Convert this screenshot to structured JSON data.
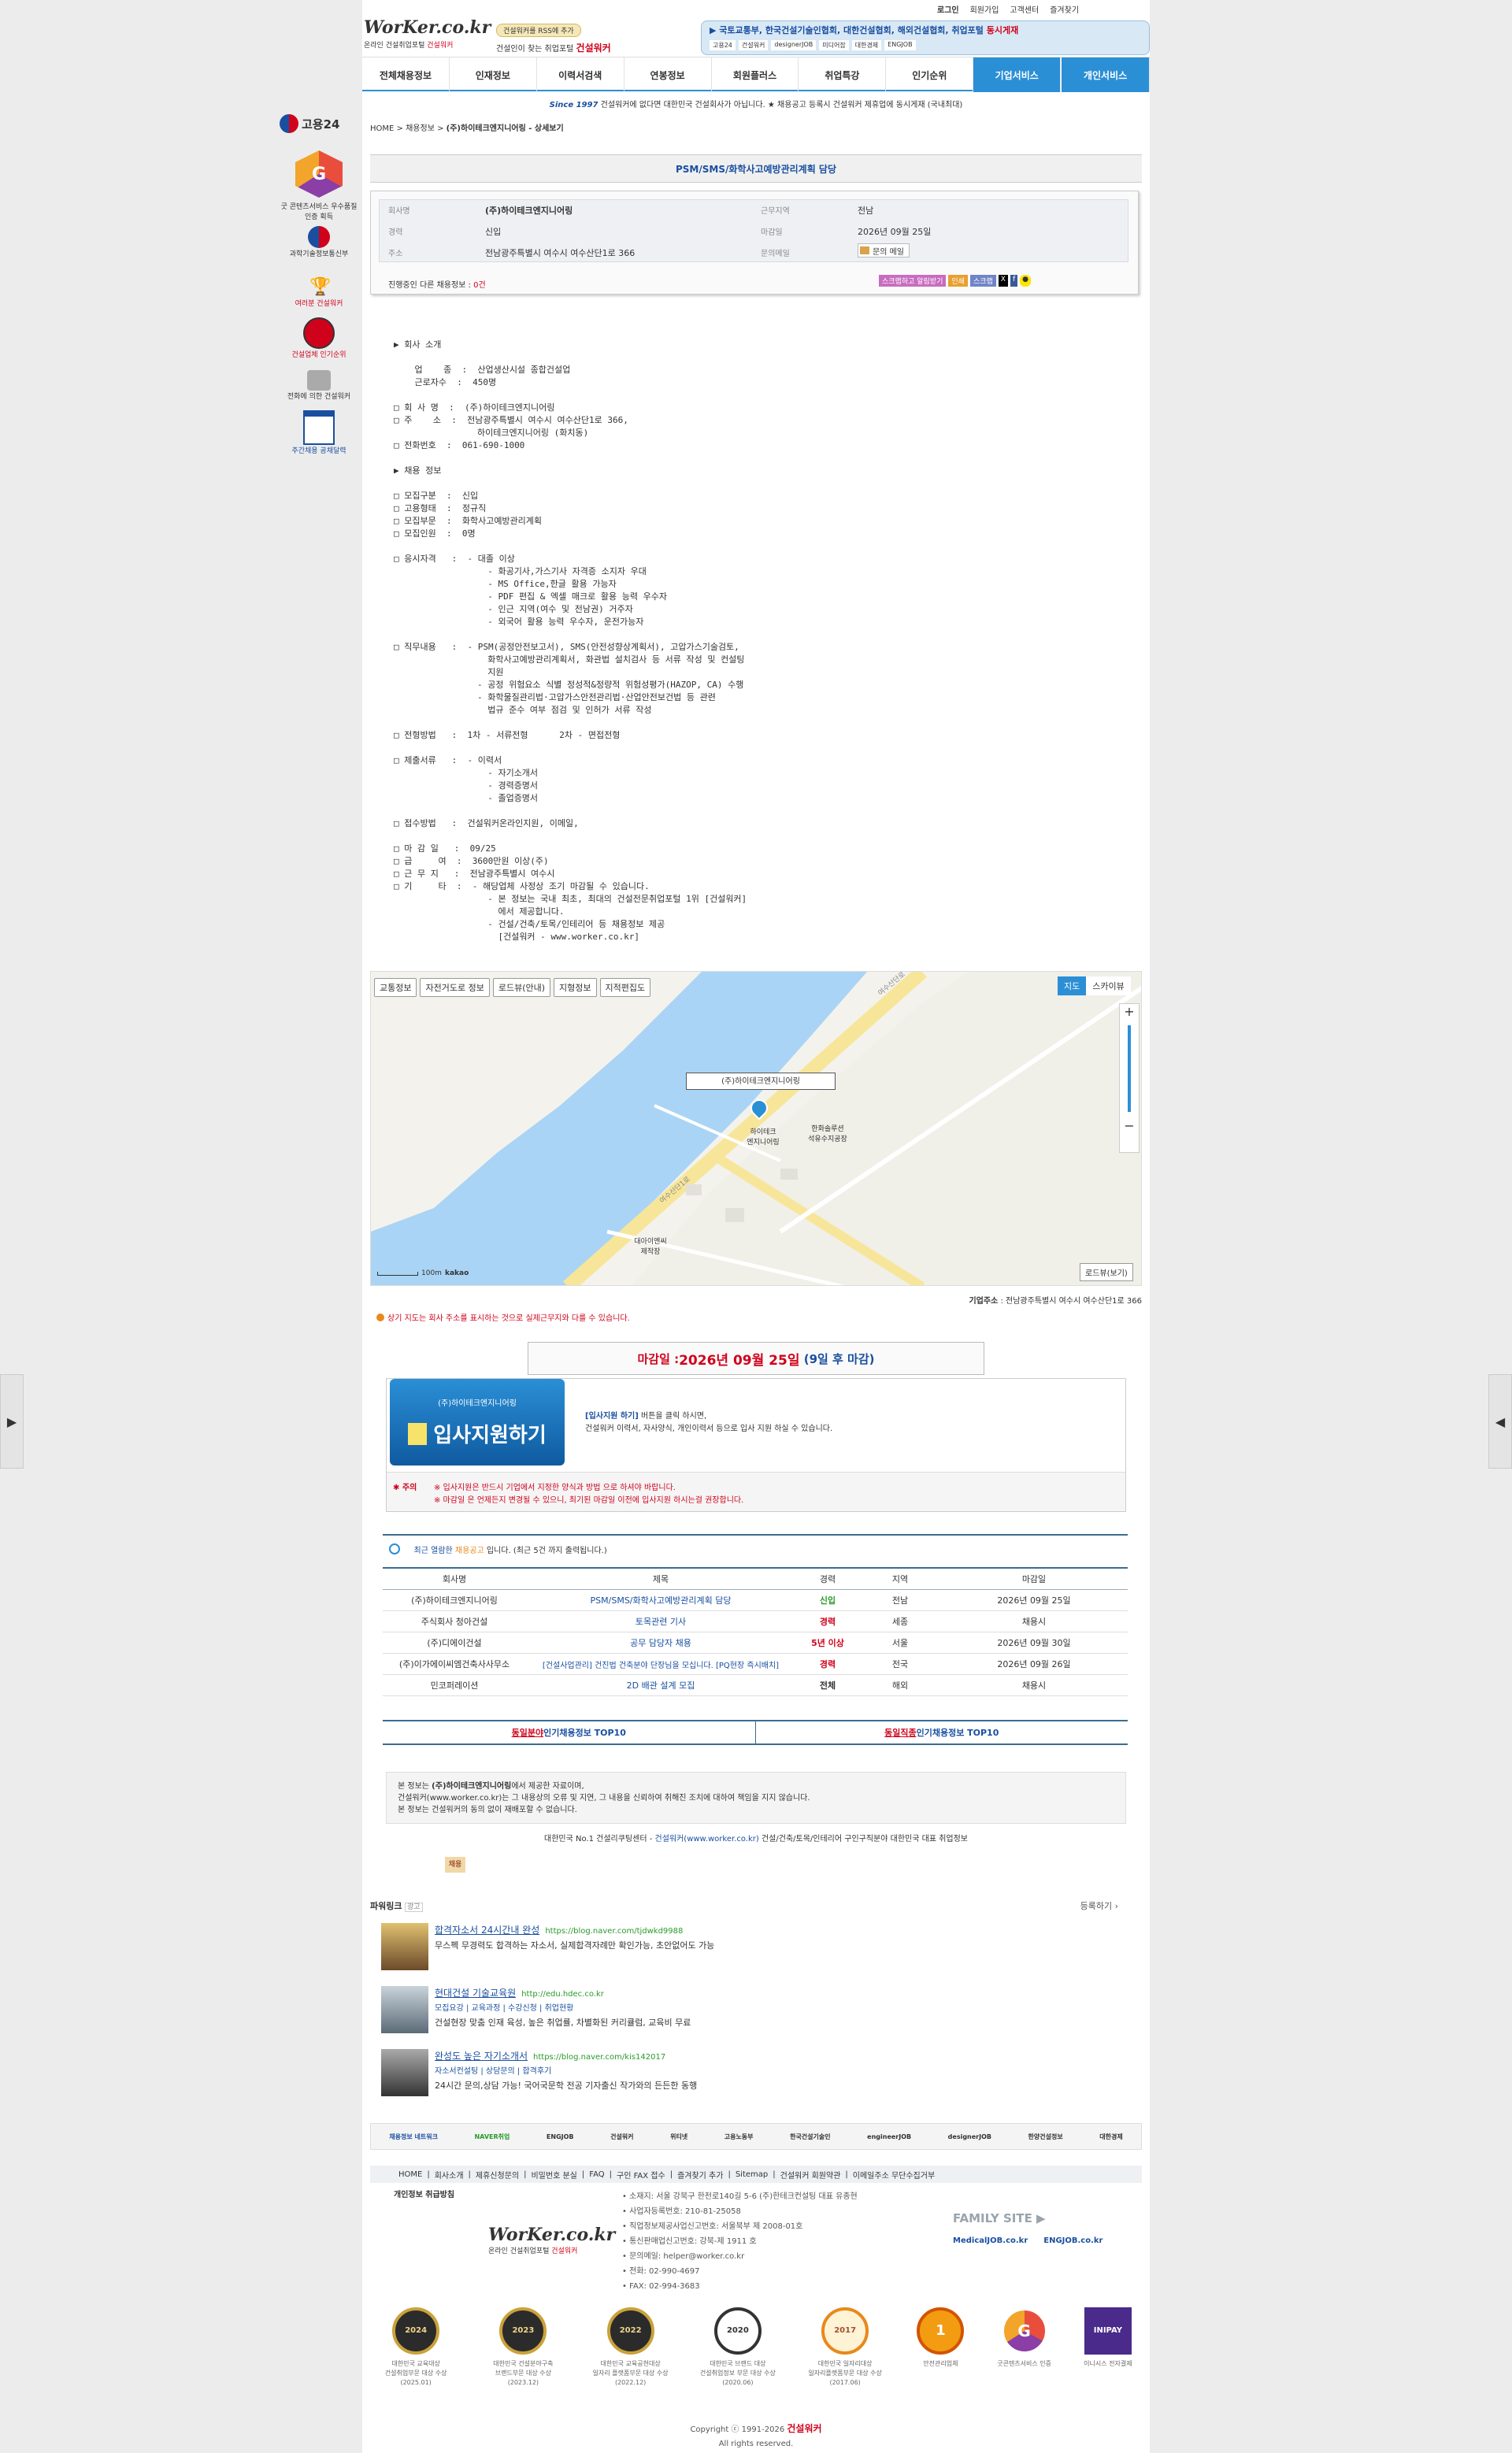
{
  "header": {
    "logo_text": "WorKer.co.kr",
    "logo_sub": "온라인 건설취업포털",
    "logo_sub_brand": "건설워커",
    "slogan_tag": "건설워커를 RSS에 추가",
    "slogan": "건설인이 찾는 취업포털",
    "slogan_brand": "건설워커",
    "top_links": [
      "로그인",
      "회원가입",
      "고객센터",
      "즐겨찾기"
    ],
    "banner_text": "▶ 국토교통부, 한국건설기술인협회, 대한건설협회, 해외건설협회, 취업포털",
    "banner_highlight": "동시게재",
    "banner_logos": [
      "고용24",
      "건설워커",
      "designerJOB",
      "미디어잡",
      "대한경제",
      "ENGJOB"
    ]
  },
  "nav": {
    "items": [
      "전체채용정보",
      "인재정보",
      "이력서검색",
      "연봉정보",
      "회원플러스",
      "취업특강",
      "인기순위"
    ],
    "special": [
      "기업서비스",
      "개인서비스"
    ]
  },
  "notice": {
    "since": "Since 1997",
    "text": "건설워커에 없다면 대한민국 건설회사가 아닙니다. ★ 채용공고 등록시 건설워커 제휴업에 동시게재 (국내최대)"
  },
  "left_sidebar": {
    "logo": "고용24",
    "award1": "굿 콘텐츠서비스 우수품질인증 획득",
    "award2": "과학기술정보통신부",
    "icon1": "여러분 건설워커",
    "icon2": "건설업체 인기순위",
    "icon3": "전화에 의한 건설워커",
    "icon4": "주간채용 공채달력"
  },
  "breadcrumb": [
    "HOME",
    "채용정보",
    "(주)하이테크엔지니어링 - 상세보기"
  ],
  "job": {
    "title": "PSM/SMS/화학사고예방관리계획 담당",
    "company_label": "회사명",
    "company": "(주)하이테크엔지니어링",
    "career_label": "경력",
    "career": "신입",
    "address_label": "주소",
    "address": "전남광주특별시 여수시 여수산단1로 366",
    "location_label": "근무지역",
    "location": "전남",
    "deadline_label": "마감일",
    "deadline": "2026년 09월 25일",
    "contact_label": "문의메일",
    "contact": "문의 메일",
    "ongoing_label": "진행중인 다른 채용정보 :",
    "ongoing_count": "0건",
    "actions": [
      "스크랩하고 알림받기",
      "인쇄",
      "스크랩"
    ]
  },
  "body_text": "▶ 회사 소개\n\n    업    종  :  산업생산시설 종합건설업\n    근로자수  :  450명\n\n□ 회 사 명  :  (주)하이테크엔지니어링\n□ 주    소  :  전남광주특별시 여수시 여수산단1로 366,\n                하이테크엔지니어링 (화치동)\n□ 전화번호  :  061-690-1000\n\n▶ 채용 정보\n\n□ 모집구분  :  신입\n□ 고용형태  :  정규직\n□ 모집부문  :  화학사고예방관리계획\n□ 모집인원  :  0명\n\n□ 응시자격   :  - 대졸 이상\n                  - 화공기사,가스기사 자격증 소지자 우대\n                  - MS Office,한글 활용 가능자\n                  - PDF 편집 & 엑셀 매크로 활용 능력 우수자\n                  - 인근 지역(여수 및 전남권) 거주자\n                  - 외국어 활용 능력 우수자, 운전가능자\n\n□ 직무내용   :  - PSM(공정안전보고서), SMS(안전성향상계획서), 고압가스기술검토,\n                  화학사고예방관리계획서, 화관법 설치검사 등 서류 작성 및 컨설팅\n                  지원\n                - 공정 위험요소 식별 정성적&정량적 위험성평가(HAZOP, CA) 수행\n                - 화학물질관리법·고압가스안전관리법·산업안전보건법 등 관련\n                  법규 준수 여부 점검 및 인허가 서류 작성\n\n□ 전형방법   :  1차 - 서류전형      2차 - 면접전형\n\n□ 제출서류   :  - 이력서\n                  - 자기소개서\n                  - 경력증명서\n                  - 졸업증명서\n\n□ 접수방법   :  건설워커온라인지원, 이메일,\n\n□ 마 감 일   :  09/25\n□ 급     여  :  3600만원 이상(주)\n□ 근 무 지   :  전남광주특별시 여수시\n□ 기     타  :  - 해당업체 사정상 조기 마감될 수 있습니다.\n                  - 본 정보는 국내 최초, 최대의 건설전문취업포털 1위 [건설워커]\n                    에서 제공합니다.\n                  - 건설/건축/토목/인테리어 등 채용정보 제공\n                    [건설워커 - www.worker.co.kr]",
  "map": {
    "buttons": [
      "교통정보",
      "자전거도로 정보",
      "로드뷰(안내)",
      "지형정보",
      "지적편집도"
    ],
    "type_buttons": [
      "지도",
      "스카이뷰"
    ],
    "marker_label": "(주)하이테크엔지니어링",
    "place1": "하이테크\n엔지니어링",
    "place2": "한화솔루션\n석유수지공장",
    "place3": "대아이엔씨\n제작장",
    "road1": "여수산단로",
    "road2": "여수산단1로",
    "scale": "100m",
    "brand": "kakao",
    "roadview": "로드뷰(보기)",
    "addr_label": "기업주소",
    "addr": "전남광주특별시 여수시 여수산단1로 366",
    "note": "상기 지도는 회사 주소를 표시하는 것으로 실제근무지와 다를 수 있습니다."
  },
  "deadline_box": {
    "label": "마감일 : ",
    "date": "2026년 09월 25일",
    "dday": "(9일 후 마감)"
  },
  "apply": {
    "company": "(주)하이테크엔지니어링",
    "button": "입사지원하기",
    "hint_strong": "[입사지원 하기]",
    "hint": " 버튼을 클릭 하시면,",
    "hint2": "건설워커 이력서, 자사양식, 개인이력서 등으로 입사 지원 하실 수 있습니다.",
    "warn_label": "주의",
    "warn1": "※ 입사지원은 반드시 기업에서 지정한 양식과 방법 으로 하셔야 바랍니다.",
    "warn2": "※ 마감일 은 언제든지 변경될 수 있으니, 최기된 마감일 이전에 입사지원 하시는걸 권장합니다."
  },
  "recent": {
    "title_pre": "최근 열람한 ",
    "title_hl": "채용공고",
    "title_post": " 입니다.   (최근 5건 까지 출력됩니다.)",
    "headers": [
      "회사명",
      "제목",
      "경력",
      "지역",
      "마감일"
    ],
    "rows": [
      [
        "(주)하이테크엔지니어링",
        "PSM/SMS/화학사고예방관리계획 담당",
        "신입",
        "전남",
        "2026년 09월 25일"
      ],
      [
        "주식회사 청아건설",
        "토목관련 기사",
        "경력",
        "세종",
        "채용시"
      ],
      [
        "(주)디에이건설",
        "공무 담당자 채용",
        "5년 이상",
        "서울",
        "2026년 09월 30일"
      ],
      [
        "(주)이가에이씨엠건축사사무소",
        "[건설사업관리] 건진법 건축분야 단장님을 모십니다. [PQ현장 즉시배치]",
        "경력",
        "전국",
        "2026년 09월 26일"
      ],
      [
        "민코퍼레이션",
        "2D 배관 설계 모집",
        "전체",
        "해외",
        "채용시"
      ]
    ]
  },
  "top10": {
    "left_hl": "동일분야",
    "left": " 인기채용정보 TOP10",
    "right_hl": "동일직종",
    "right": " 인기채용정보 TOP10"
  },
  "disclaimer": {
    "l1_pre": "본 정보는 ",
    "l1_co": "(주)하이테크엔지니어링",
    "l1_post": "에서 제공한 자료이며,",
    "l2": "건설워커(www.worker.co.kr)는 그 내용상의 오류 및 지연, 그 내용을 신뢰하여 취해진 조치에 대하여 책임을 지지 않습니다.",
    "l3": "본 정보는 건설워커의 동의 없이 재배포할 수 없습니다.",
    "tagline_pre": "대한민국 No.1 건설리쿠팅센터 - ",
    "tagline_brand": "건설워커(www.worker.co.kr)",
    "tagline_post": " 건설/건축/토목/인테리어 구인구직분야 대한민국 대표 취업정보",
    "hiring": "채용"
  },
  "powerlink": {
    "title": "파워링크",
    "ad": "광고",
    "register": "등록하기 ›",
    "items": [
      {
        "title": "합격자소서 24시간내 완성",
        "url": "https://blog.naver.com/tjdwkd9988",
        "sub": "",
        "desc": "무스펙 무경력도 합격하는 자소서, 실제합격자례만 확인가능, 초안없어도 가능"
      },
      {
        "title": "현대건설 기술교육원",
        "url": "http://edu.hdec.co.kr",
        "sub": "모집요강 | 교육과정 | 수강신청 | 취업현황",
        "desc": "건설현장 맞춤 인재 육성, 높은 취업률, 차별화된 커리큘럼, 교육비 무료"
      },
      {
        "title": "완성도 높은 자기소개서",
        "url": "https://blog.naver.com/kis142017",
        "sub": "자소서컨설팅 | 상담문의 | 합격후기",
        "desc": "24시간 문의,상담 가능! 국어국문학 전공 기자출신 작가와의 든든한 동행"
      }
    ]
  },
  "partners": [
    "채용정보 네트워크",
    "NAVER취업",
    "ENGJOB",
    "건설워커",
    "위티넷",
    "고용노동부",
    "한국건설기술인",
    "engineerJOB",
    "designerJOB",
    "한양건설정보",
    "대한경제"
  ],
  "footer": {
    "links": [
      "HOME",
      "회사소개",
      "제휴신청문의",
      "비밀번호 분실",
      "FAQ",
      "구인 FAX 접수",
      "즐겨찾기 추가",
      "Sitemap",
      "건설워커 회원약관",
      "이메일주소 무단수집거부"
    ],
    "privacy": "개인정보 취급방침",
    "info": [
      "소재지: 서울 강북구 한천로140길 5-6 (주)한테크컨설팅 대표 유종현",
      "사업자등록번호: 210-81-25058",
      "직업정보제공사업신고번호: 서울북부 제 2008-01호",
      "통신판매업신고번호: 강북-제 1911 호",
      "문의메일: helper@worker.co.kr",
      "전화: 02-990-4697",
      "FAX: 02-994-3683"
    ],
    "family_title": "FAMILY SITE ▶",
    "family": [
      "MedicalJOB.co.kr",
      "ENGJOB.co.kr"
    ],
    "awards": [
      {
        "badge": "2024",
        "text": "대한민국 교육대상\n건설취업부문 대상 수상\n(2025.01)"
      },
      {
        "badge": "2023",
        "text": "대한민국 건설분야구축\n브랜드부문 대상 수상\n(2023.12)"
      },
      {
        "badge": "2022",
        "text": "대한민국 교육공헌대상\n일자리 플랫폼부문 대상 수상\n(2022.12)"
      },
      {
        "badge": "2020",
        "text": "대한민국 브랜드 대상\n건설취업정보 부문 대상 수상\n(2020.06)"
      },
      {
        "badge": "2017",
        "text": "대한민국 일자리대상\n일자리플랫폼부문 대상 수상\n(2017.06)"
      },
      {
        "badge": "1",
        "text": "안전관리업체"
      },
      {
        "badge": "G",
        "text": "굿콘텐츠서비스 인증"
      },
      {
        "badge": "INIPAY",
        "text": "이니시스 전자결제"
      }
    ],
    "copyright": "Copyright ⓒ 1991-2026 ",
    "brand": "건설워커",
    "rights": "All rights reserved."
  },
  "colors": {
    "nav_blue": "#2b8fd6",
    "brand_blue": "#1a4fa0",
    "deadline_red": "#d0021b",
    "table_border": "#3c6c8e"
  }
}
